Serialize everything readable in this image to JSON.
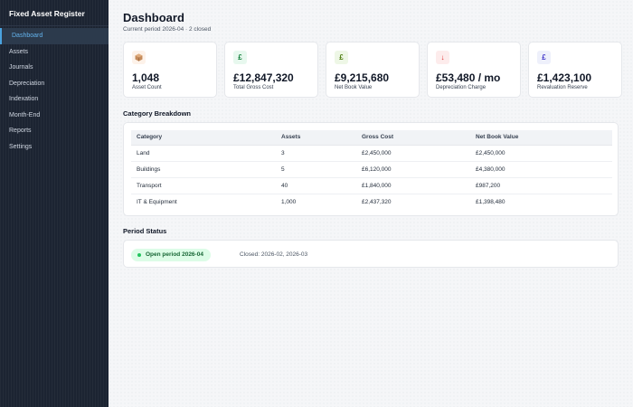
{
  "app": {
    "title": "Fixed Asset Register"
  },
  "sidebar": {
    "items": [
      {
        "label": "Dashboard",
        "active": true
      },
      {
        "label": "Assets"
      },
      {
        "label": "Journals"
      },
      {
        "label": "Depreciation"
      },
      {
        "label": "Indexation"
      },
      {
        "label": "Month-End"
      },
      {
        "label": "Reports"
      },
      {
        "label": "Settings"
      }
    ]
  },
  "header": {
    "title": "Dashboard",
    "subtitle": "Current period 2026-04 · 2 closed"
  },
  "stats": [
    {
      "icon": "box-icon",
      "glyph": "📦",
      "value": "1,048",
      "label": "Asset Count",
      "icon_bg": "#fdf2e9",
      "icon_color": "#92400e"
    },
    {
      "icon": "pound-icon",
      "glyph": "£",
      "value": "£12,847,320",
      "label": "Total Gross Cost",
      "icon_bg": "#e7f8ee",
      "icon_color": "#15803d"
    },
    {
      "icon": "pound-icon",
      "glyph": "£",
      "value": "£9,215,680",
      "label": "Net Book Value",
      "icon_bg": "#eef7e6",
      "icon_color": "#4d7c0f"
    },
    {
      "icon": "arrow-down-icon",
      "glyph": "↓",
      "value": "£53,480 / mo",
      "label": "Depreciation Charge",
      "icon_bg": "#fdecec",
      "icon_color": "#dc2626"
    },
    {
      "icon": "pound-icon",
      "glyph": "£",
      "value": "£1,423,100",
      "label": "Revaluation Reserve",
      "icon_bg": "#eef0fb",
      "icon_color": "#4338ca"
    }
  ],
  "category": {
    "title": "Category Breakdown",
    "columns": [
      "Category",
      "Assets",
      "Gross Cost",
      "Net Book Value"
    ],
    "rows": [
      [
        "Land",
        "3",
        "£2,450,000",
        "£2,450,000"
      ],
      [
        "Buildings",
        "5",
        "£6,120,000",
        "£4,380,000"
      ],
      [
        "Transport",
        "40",
        "£1,840,000",
        "£987,200"
      ],
      [
        "IT & Equipment",
        "1,000",
        "£2,437,320",
        "£1,398,480"
      ]
    ]
  },
  "period": {
    "title": "Period Status",
    "open_label": "Open period 2026-04",
    "closed_label": "Closed: 2026-02, 2026-03"
  }
}
